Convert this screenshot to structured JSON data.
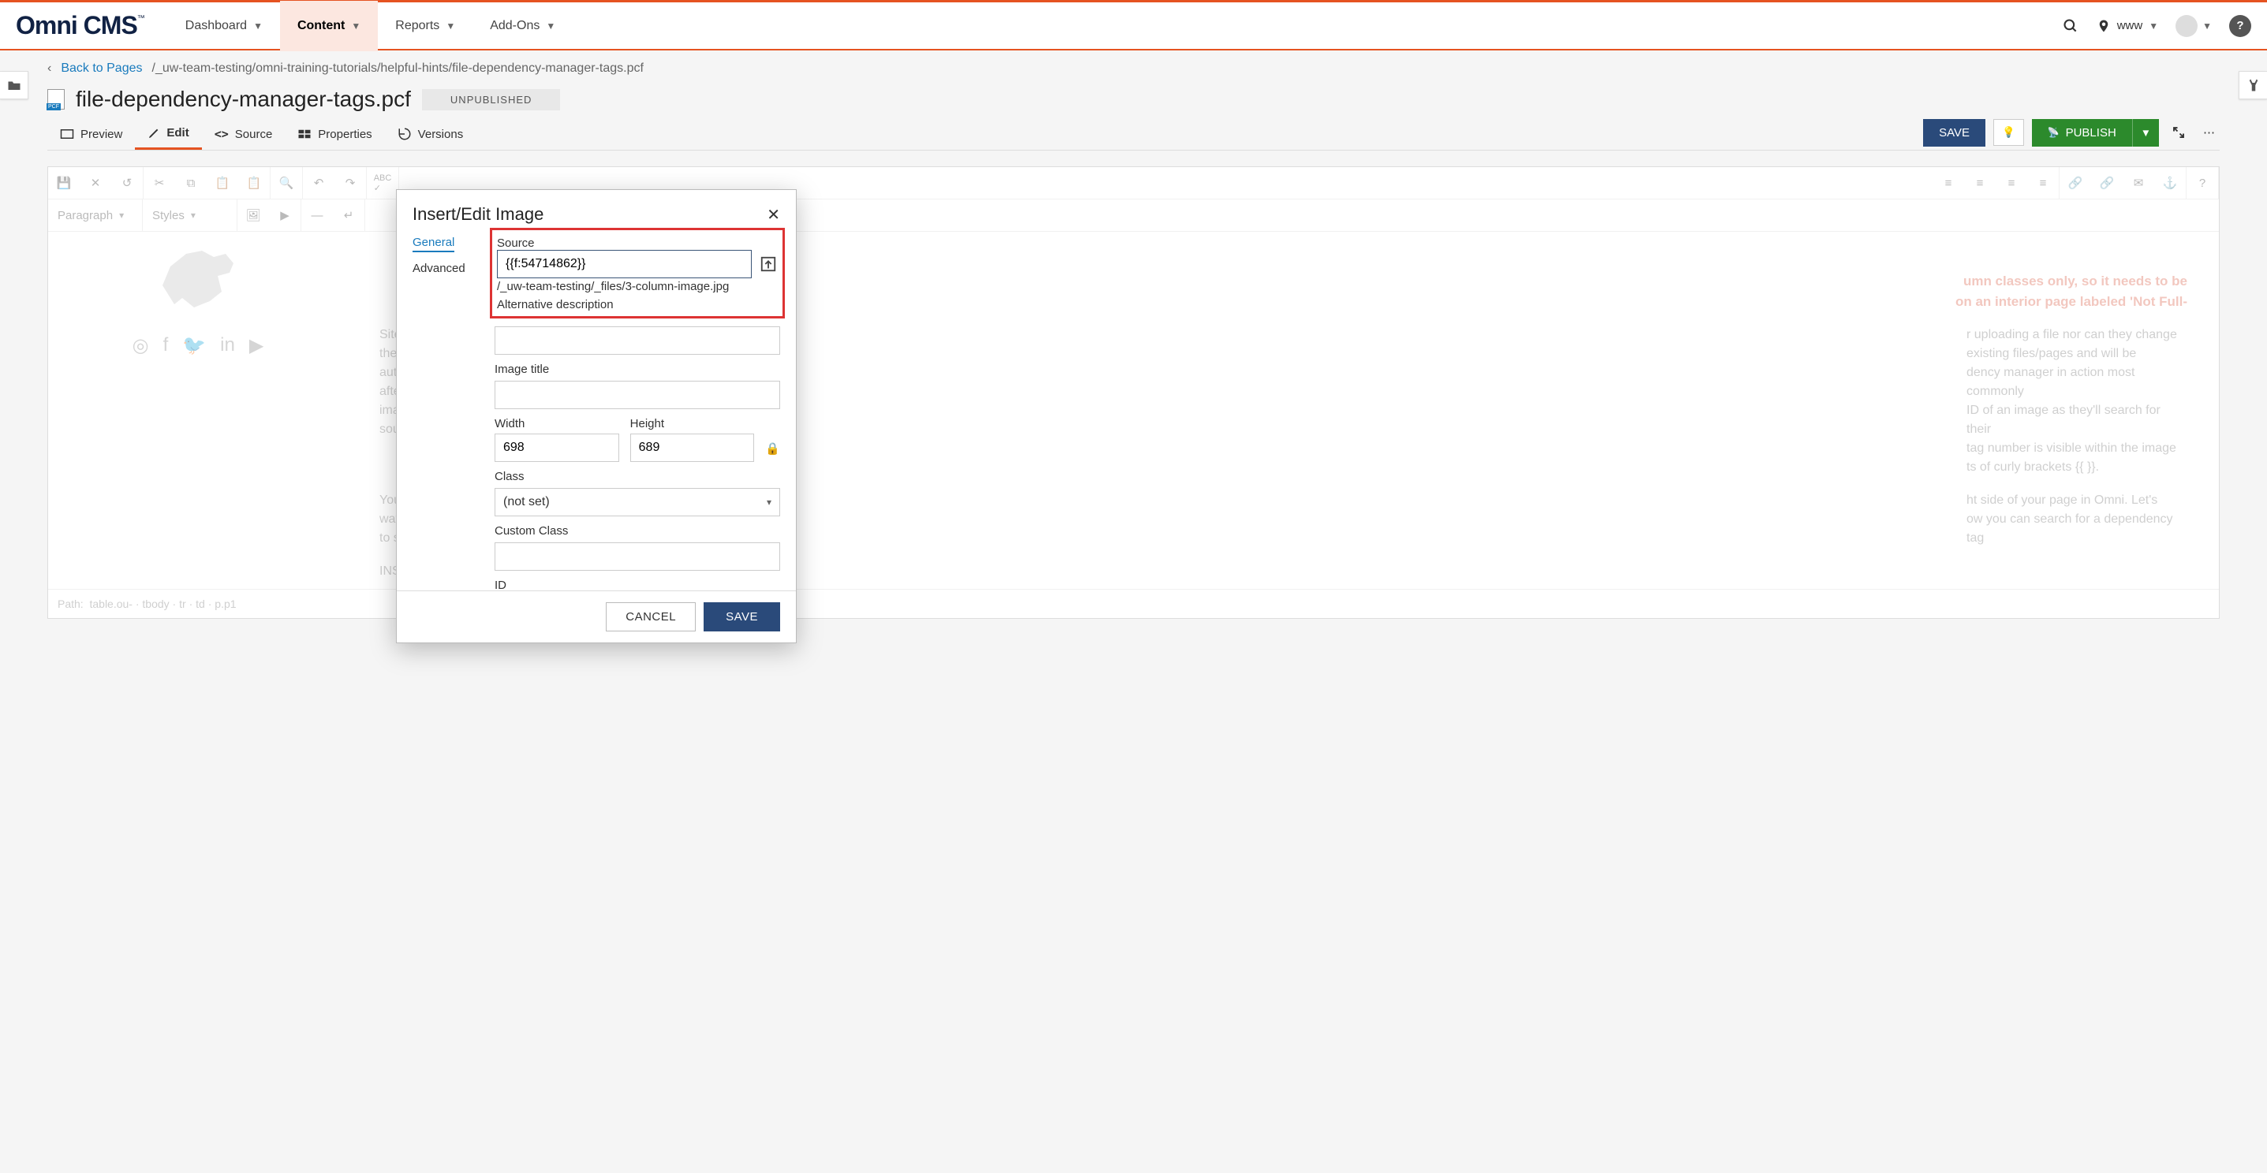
{
  "brand": "Omni CMS",
  "nav": {
    "dashboard": "Dashboard",
    "content": "Content",
    "reports": "Reports",
    "addons": "Add-Ons"
  },
  "site_name": "www",
  "back_link": "Back to Pages",
  "breadcrumb_path": "/_uw-team-testing/omni-training-tutorials/helpful-hints/file-dependency-manager-tags.pcf",
  "page_title": "file-dependency-manager-tags.pcf",
  "status": "UNPUBLISHED",
  "tabs": {
    "preview": "Preview",
    "edit": "Edit",
    "source": "Source",
    "properties": "Properties",
    "versions": "Versions"
  },
  "actions": {
    "save": "SAVE",
    "publish": "PUBLISH"
  },
  "format_sel": {
    "paragraph": "Paragraph",
    "styles": "Styles"
  },
  "canvas": {
    "red1": "umn classes only, so it needs to be",
    "red2": "on an interior page labeled 'Not Full-",
    "p1a": "Site",
    "p1b": "r uploading a file nor can they change",
    "p1c": "the",
    "p1d": "existing files/pages and will be",
    "p1e": "aut",
    "p1f": "dency manager in action most commonly",
    "p1g": "afte",
    "p1h": "ID of an image as they'll search for their",
    "p1i": "ima",
    "p1j": "tag number is visible within the image",
    "p1k": "sou",
    "p1l": "ts of curly brackets {{  }}.",
    "p2a": "You",
    "p2b": "ht side of your page in Omni. Let's",
    "p2c": "wat",
    "p2d": "ow you can search for a dependency tag",
    "p2e": "to s",
    "p3": "INS"
  },
  "path_bar": {
    "label": "Path:",
    "seg1": "table.ou-",
    "seg2": "tbody",
    "seg3": "tr",
    "seg4": "td",
    "seg5": "p.p1"
  },
  "modal": {
    "title": "Insert/Edit Image",
    "tab_general": "General",
    "tab_advanced": "Advanced",
    "src_label": "Source",
    "src_value": "{{f:54714862}}",
    "src_path": "/_uw-team-testing/_files/3-column-image.jpg",
    "alt_label": "Alternative description",
    "imgtitle_label": "Image title",
    "width_label": "Width",
    "width_value": "698",
    "height_label": "Height",
    "height_value": "689",
    "class_label": "Class",
    "class_value": "(not set)",
    "custom_class_label": "Custom Class",
    "id_label": "ID",
    "cancel": "CANCEL",
    "save": "SAVE"
  }
}
